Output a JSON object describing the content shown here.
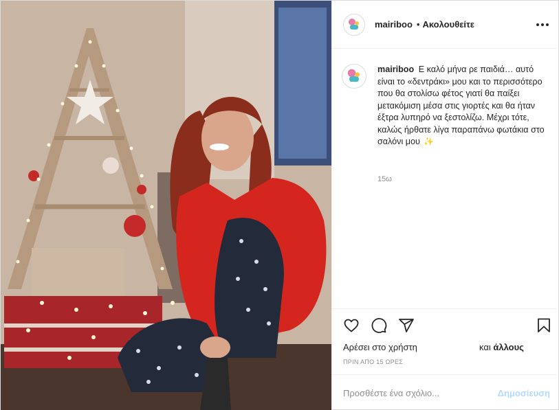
{
  "post": {
    "username": "mairiboo",
    "separator": "•",
    "follow_label": "Ακολουθείτε",
    "more_icon": "more-horizontal-icon",
    "caption_username": "mairiboo",
    "caption_text": "Ε καλό μήνα ρε παιδιά… αυτό είναι το «δεντράκι» μου και το περισσότερο που θα στολίσω φέτος γιατί θα παίξει μετακόμιση μέσα στις γιορτές και θα ήταν έξτρα λυπηρό να ξεστολίζω. Μέχρι τότε, καλώς ήρθατε λίγα παραπάνω φωτάκια στο σαλόνι μου",
    "caption_emoji": "✨",
    "time": "15ω",
    "likes_text": "Αρέσει στο χρήστη",
    "likes_and": "και",
    "likes_others": "άλλους",
    "ago": "ΠΡΙΝ ΑΠΟ 15 ΩΡΕΣ"
  },
  "actions": {
    "like_icon": "heart-icon",
    "comment_icon": "comment-icon",
    "share_icon": "share-icon",
    "save_icon": "bookmark-icon"
  },
  "comment": {
    "placeholder": "Προσθέστε ένα σχόλιο...",
    "post_label": "Δημοσίευση"
  },
  "colors": {
    "text": "#262626",
    "muted": "#8e8e8e",
    "border": "#efefef",
    "post_disabled": "#b3dbff",
    "sweater": "#d4261f"
  }
}
